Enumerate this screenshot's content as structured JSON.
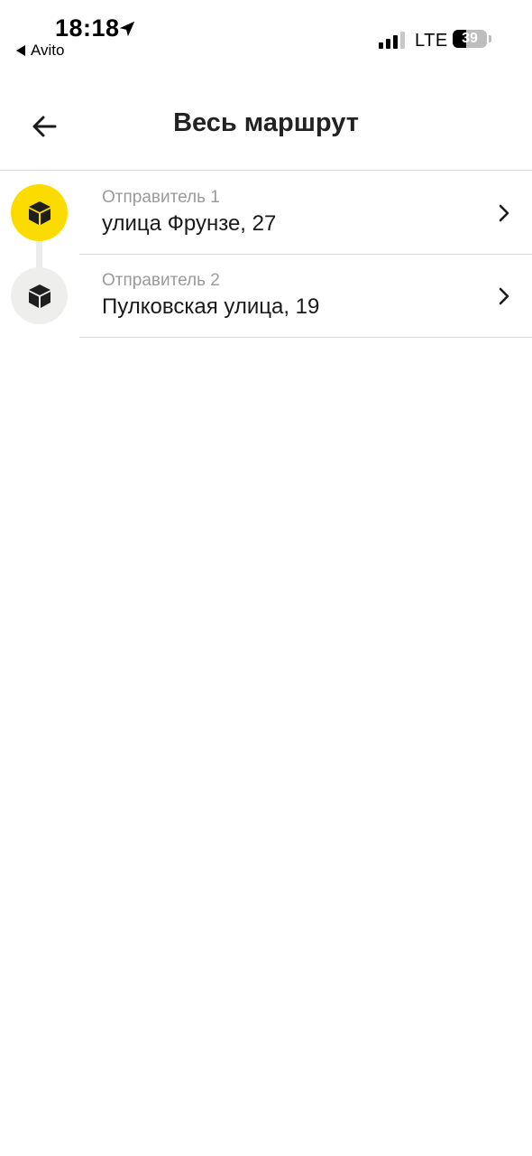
{
  "status_bar": {
    "time": "18:18",
    "back_app": "Avito",
    "network": "LTE",
    "battery_level": "39",
    "battery_fraction": 0.39,
    "signal_bars_active": 3,
    "signal_bars_total": 4
  },
  "header": {
    "title": "Весь маршрут",
    "back_icon": "arrow-left-icon"
  },
  "route": {
    "items": [
      {
        "label": "Отправитель 1",
        "address": "улица Фрунзе, 27",
        "marker_color": "#FCDC00",
        "icon": "package-box-icon"
      },
      {
        "label": "Отправитель 2",
        "address": "Пулковская улица, 19",
        "marker_color": "#EEEEEC",
        "icon": "package-box-icon"
      }
    ],
    "chevron_icon": "chevron-right-icon"
  },
  "colors": {
    "accent": "#FCDC00",
    "secondary_text": "#9A9A9A",
    "divider": "#D9D9D9"
  }
}
